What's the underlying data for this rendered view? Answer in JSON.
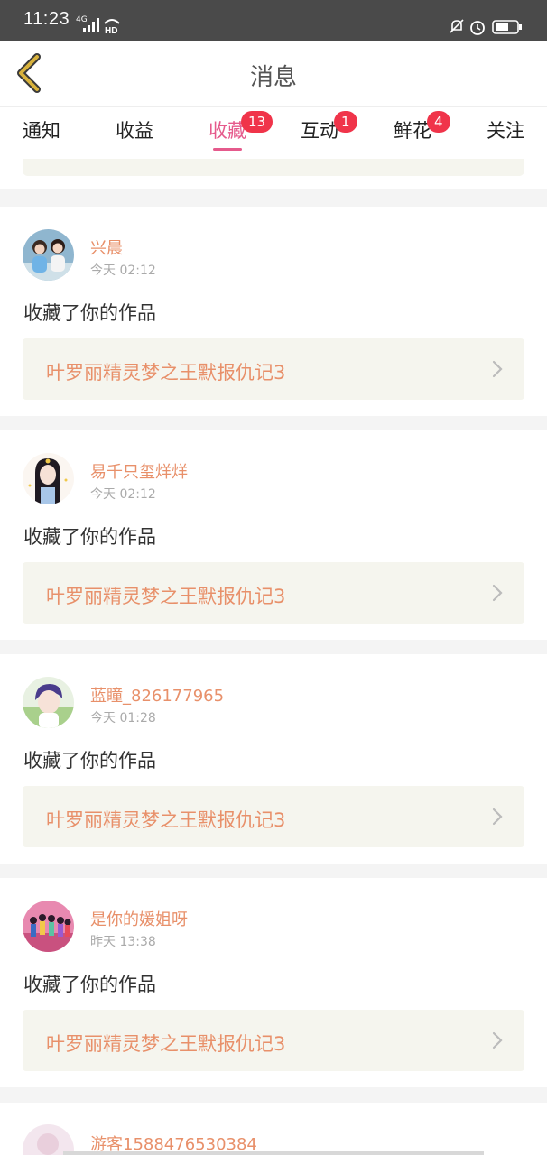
{
  "status_bar": {
    "time": "11:23",
    "network": "4G"
  },
  "header": {
    "title": "消息"
  },
  "tabs": [
    {
      "label": "通知",
      "badge": ""
    },
    {
      "label": "收益",
      "badge": ""
    },
    {
      "label": "收藏",
      "badge": "13",
      "active": true
    },
    {
      "label": "互动",
      "badge": "1"
    },
    {
      "label": "鲜花",
      "badge": "4"
    },
    {
      "label": "关注",
      "badge": ""
    }
  ],
  "messages": [
    {
      "username": "兴晨",
      "time": "今天 02:12",
      "action": "收藏了你的作品",
      "work_title": "叶罗丽精灵梦之王默报仇记3"
    },
    {
      "username": "易千只玺烊烊",
      "time": "今天 02:12",
      "action": "收藏了你的作品",
      "work_title": "叶罗丽精灵梦之王默报仇记3"
    },
    {
      "username": "蓝瞳_826177965",
      "time": "今天 01:28",
      "action": "收藏了你的作品",
      "work_title": "叶罗丽精灵梦之王默报仇记3"
    },
    {
      "username": "是你的媛姐呀",
      "time": "昨天 13:38",
      "action": "收藏了你的作品",
      "work_title": "叶罗丽精灵梦之王默报仇记3"
    },
    {
      "username": "游客1588476530384"
    }
  ],
  "colors": {
    "accent": "#e55a8c",
    "badge": "#f0344a",
    "name": "#e8906a",
    "back": "#d8b23c"
  }
}
